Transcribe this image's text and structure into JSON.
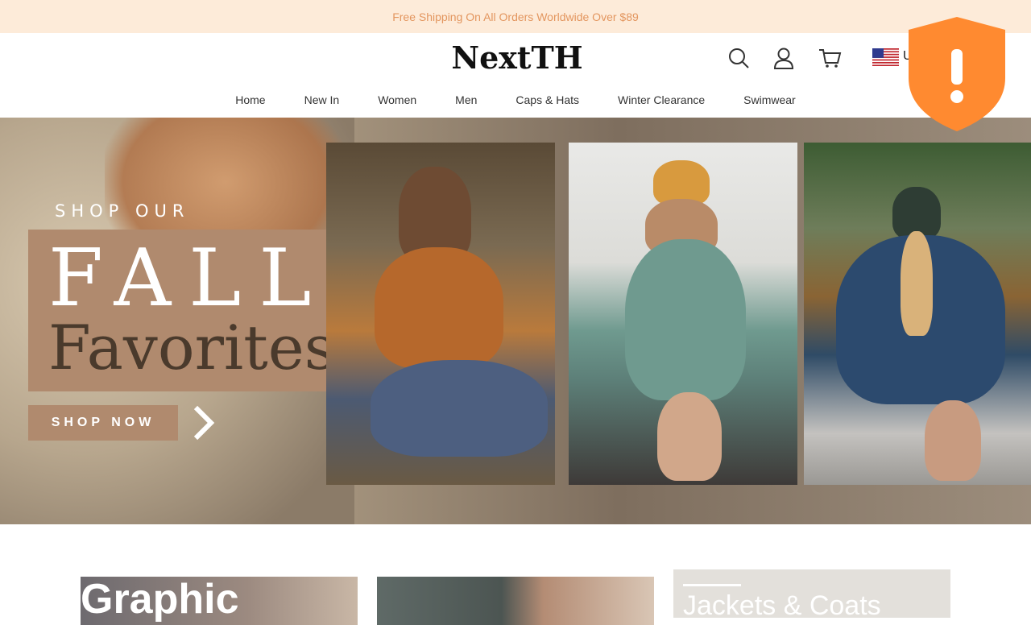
{
  "announcement": {
    "text": "Free Shipping On All Orders Worldwide Over $89"
  },
  "header": {
    "logo": "NextTH",
    "currency_code": "U",
    "icons": [
      "search-icon",
      "account-icon",
      "cart-icon",
      "us-flag-icon"
    ]
  },
  "nav": {
    "items": [
      {
        "label": "Home"
      },
      {
        "label": "New In"
      },
      {
        "label": "Women"
      },
      {
        "label": "Men"
      },
      {
        "label": "Caps & Hats"
      },
      {
        "label": "Winter Clearance"
      },
      {
        "label": "Swimwear"
      }
    ]
  },
  "hero": {
    "kicker": "SHOP OUR",
    "title_line1": "FALL",
    "title_line2": "Favorites",
    "cta_label": "SHOP NOW"
  },
  "categories": [
    {
      "label": "Graphic"
    },
    {
      "label": ""
    },
    {
      "label": "Jackets & Coats"
    }
  ],
  "colors": {
    "announcement_bg": "#fdebd9",
    "announcement_text": "#e3965f",
    "hero_accent": "#b08a6e",
    "shield": "#ff8a30"
  }
}
